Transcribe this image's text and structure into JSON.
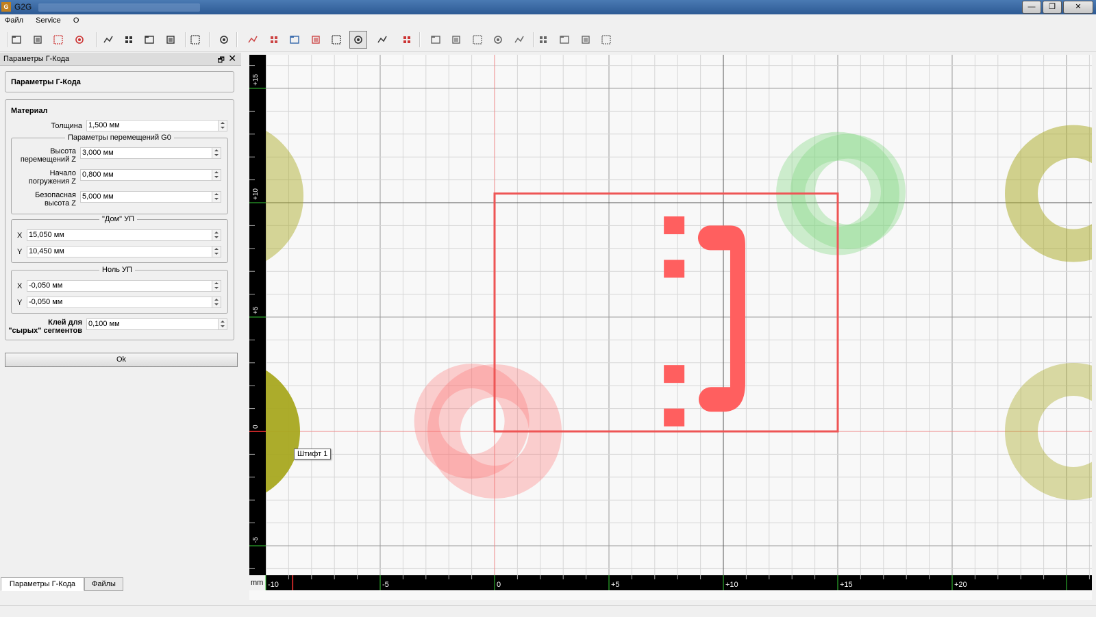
{
  "window": {
    "app_icon_text": "G",
    "title": "G2G",
    "minimize": "—",
    "maximize": "❐",
    "close": "✕"
  },
  "menu": [
    "Файл",
    "Service",
    "О"
  ],
  "dock": {
    "title": "Параметры Г-Кода",
    "float_icon": "🗗",
    "close_icon": "✕",
    "section_title": "Параметры Г-Кода",
    "material": {
      "title": "Материал",
      "thickness_label": "Толщина",
      "thickness_value": "1,500 мм",
      "g0": {
        "title": "Параметры перемещений G0",
        "travel_z_label_1": "Высота",
        "travel_z_label_2": "перемещений Z",
        "travel_z_value": "3,000 мм",
        "plunge_label_1": "Начало",
        "plunge_label_2": "погружения Z",
        "plunge_value": "0,800 мм",
        "safe_label_1": "Безопасная",
        "safe_label_2": "высота Z",
        "safe_value": "5,000 мм"
      },
      "home": {
        "title": "\"Дом\" УП",
        "x_label": "X",
        "x_value": "15,050 мм",
        "y_label": "Y",
        "y_value": "10,450 мм"
      },
      "zero": {
        "title": "Ноль УП",
        "x_label": "X",
        "x_value": "-0,050 мм",
        "y_label": "Y",
        "y_value": "-0,050 мм"
      },
      "glue_label_1": "Клей для",
      "glue_label_2": "\"сырых\" сегментов",
      "glue_value": "0,100 мм"
    },
    "ok_label": "Ok",
    "tabs": [
      "Параметры Г-Кода",
      "Файлы"
    ]
  },
  "toolbar": {
    "icons": [
      "open-folder-icon",
      "save-icon",
      "pdf-icon",
      "close-file-icon",
      "zoom-fit-icon",
      "zoom-all-icon",
      "zoom-selection-icon",
      "zoom-in-icon",
      "zoom-out-icon",
      "group-icon",
      "layer-icon",
      "layer-2-icon",
      "toolpath-icon",
      "drill-icon",
      "points-icon",
      "gcode-icon",
      "list-icon",
      "fit-red-icon",
      "rect-icon",
      "line-icon",
      "ellipse-icon",
      "arc-icon",
      "text-icon",
      "union-icon",
      "subtract-icon",
      "intersect-icon",
      "offset-icon"
    ]
  },
  "canvas": {
    "unit_label": "mm",
    "x_ticks": [
      "-10",
      "-5",
      "0",
      "+5",
      "+10",
      "+15",
      "+20"
    ],
    "y_ticks": [
      "+15",
      "+10",
      "+5",
      "0",
      "-5"
    ],
    "tooltip": "Штифт 1",
    "colors": {
      "red": "#ff6a6a",
      "olive": "#a8a820",
      "green": "#7cd87c",
      "grid": "#d6d6d6",
      "ruler": "#000000"
    }
  }
}
